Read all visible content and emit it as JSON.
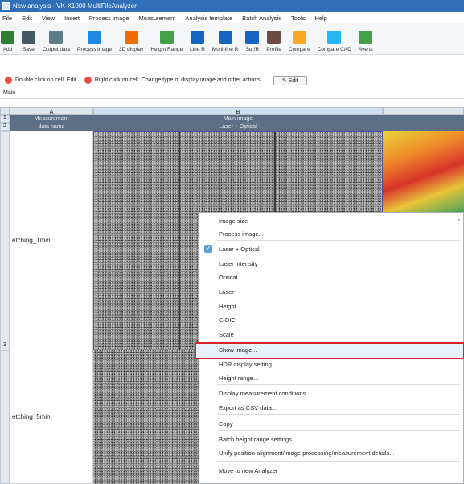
{
  "window": {
    "title": "New analysis - VK-X1000 MultiFileAnalyzer"
  },
  "menu": [
    "File",
    "Edit",
    "View",
    "Insert",
    "Process image",
    "Measurement",
    "Analysis template",
    "Batch Analysis",
    "Tools",
    "Help"
  ],
  "toolbar": {
    "buttons": [
      {
        "label": "Add",
        "icon": "add-icon",
        "color": "#2e7d32"
      },
      {
        "label": "Save",
        "icon": "save-icon",
        "color": "#455a64"
      },
      {
        "label": "Output data",
        "icon": "output-icon",
        "color": "#607d8b"
      },
      {
        "label": "Process image",
        "icon": "process-image-icon",
        "color": "#1e88e5"
      },
      {
        "label": "3D display",
        "icon": "3d-icon",
        "color": "#ef6c00"
      },
      {
        "label": "Height Range",
        "icon": "height-range-icon",
        "color": "#43a047"
      },
      {
        "label": "Line R",
        "icon": "line-r-icon",
        "color": "#1565c0"
      },
      {
        "label": "Multi-line R",
        "icon": "multi-line-r-icon",
        "color": "#1565c0"
      },
      {
        "label": "SurfR",
        "icon": "surf-r-icon",
        "color": "#1565c0"
      },
      {
        "label": "Profile",
        "icon": "profile-icon",
        "color": "#6d4c41"
      },
      {
        "label": "Compare",
        "icon": "compare-icon",
        "color": "#f9a825"
      },
      {
        "label": "Compare CAD",
        "icon": "compare-cad-icon",
        "color": "#29b6f6"
      },
      {
        "label": "Ave st",
        "icon": "ave-st-icon",
        "color": "#43a047"
      }
    ]
  },
  "hints": {
    "double_click": "Double click on cell: Edit",
    "right_click": "Right click on cell: Change type of display image and other actions",
    "edit_button": "Edit"
  },
  "tabs": {
    "main": "Main"
  },
  "sheet": {
    "col_a": "A",
    "col_b": "B",
    "row1_label": "Measurement",
    "row2_label": "data name",
    "main_image": "Main image",
    "image_type": "Laser + Optical",
    "rows": [
      {
        "num": "1"
      },
      {
        "num": "2"
      },
      {
        "num": "3",
        "name": "etching_1min"
      },
      {
        "num": "",
        "name": "etching_5min"
      }
    ]
  },
  "context_menu": {
    "items": [
      {
        "label": "Image size",
        "arrow": "›"
      },
      {
        "label": "Process image..."
      },
      {
        "label": "Laser + Optical",
        "checked": true
      },
      {
        "label": "Laser intensity"
      },
      {
        "label": "Optical"
      },
      {
        "label": "Laser"
      },
      {
        "label": "Height"
      },
      {
        "label": "C-DIC"
      },
      {
        "label": "Scale"
      },
      {
        "label": "Show image..."
      },
      {
        "label": "HDR display setting..."
      },
      {
        "label": "Height range..."
      },
      {
        "label": "Display measurement conditions..."
      },
      {
        "label": "Export as CSV data..."
      },
      {
        "label": "Copy"
      },
      {
        "label": "Batch height range settings..."
      },
      {
        "label": "Unify position alignment/image processing/measurement details..."
      },
      {
        "label": "Move to new Analyzer"
      }
    ],
    "highlighted": "Show image...",
    "highlight_color": "#d8232a"
  }
}
